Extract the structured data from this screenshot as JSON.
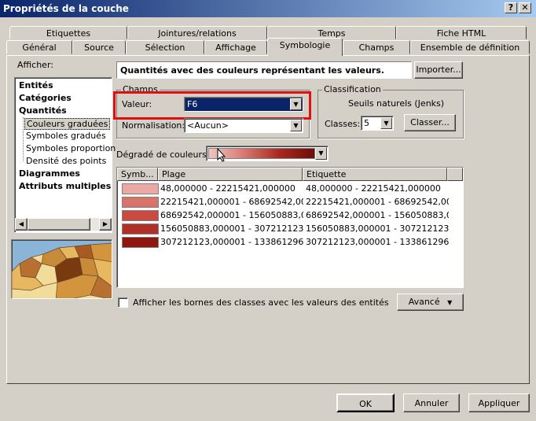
{
  "window": {
    "title": "Propriétés de la couche",
    "help_label": "?",
    "close_label": "✕"
  },
  "tabs_row1": [
    {
      "label": "Etiquettes"
    },
    {
      "label": "Jointures/relations"
    },
    {
      "label": "Temps"
    },
    {
      "label": "Fiche HTML"
    }
  ],
  "tabs_row2": [
    {
      "label": "Général"
    },
    {
      "label": "Source"
    },
    {
      "label": "Sélection"
    },
    {
      "label": "Affichage"
    },
    {
      "label": "Symbologie"
    },
    {
      "label": "Champs"
    },
    {
      "label": "Ensemble de définition"
    }
  ],
  "sidebar": {
    "afficher_label": "Afficher:",
    "items": [
      {
        "label": "Entités"
      },
      {
        "label": "Catégories"
      },
      {
        "label": "Quantités"
      },
      {
        "label": "Couleurs graduées"
      },
      {
        "label": "Symboles gradués"
      },
      {
        "label": "Symboles proportion"
      },
      {
        "label": "Densité des points"
      },
      {
        "label": "Diagrammes"
      },
      {
        "label": "Attributs multiples"
      }
    ]
  },
  "main": {
    "heading": "Quantités avec des couleurs représentant les valeurs.",
    "importer_label": "Importer...",
    "champs": {
      "group_label": "Champs",
      "valeur_label": "Valeur:",
      "valeur_value": "F6",
      "normalisation_label": "Normalisation:",
      "normalisation_value": "<Aucun>"
    },
    "classification": {
      "group_label": "Classification",
      "method": "Seuils naturels (Jenks)",
      "classes_label": "Classes:",
      "classes_value": "5",
      "classer_label": "Classer..."
    },
    "degrade_label": "Dégradé de couleurs:",
    "table": {
      "headers": [
        "Symb...",
        "Plage",
        "Etiquette"
      ],
      "rows": [
        {
          "color": "#eba8a4",
          "plage": "48,000000 - 22215421,000000",
          "etiquette": "48,000000 - 22215421,000000"
        },
        {
          "color": "#d9736a",
          "plage": "22215421,000001 - 68692542,00000(",
          "etiquette": "22215421,000001 - 68692542,00000("
        },
        {
          "color": "#c84a40",
          "plage": "68692542,000001 - 156050883,000(",
          "etiquette": "68692542,000001 - 156050883,000001"
        },
        {
          "color": "#b03028",
          "plage": "156050883,000001 - 307212123,00(",
          "etiquette": "156050883,000001 - 307212123,00("
        },
        {
          "color": "#8e1810",
          "plage": "307212123,000001 - 1338612968,0(",
          "etiquette": "307212123,000001 - 1338612968,0("
        }
      ]
    },
    "afficher_bornes_label": "Afficher les bornes des classes avec les valeurs des entités",
    "avance_label": "Avancé"
  },
  "footer": {
    "ok_label": "OK",
    "annuler_label": "Annuler",
    "appliquer_label": "Appliquer"
  },
  "colors": {
    "highlight": "#0a246a",
    "red_annotation": "#e01010"
  }
}
